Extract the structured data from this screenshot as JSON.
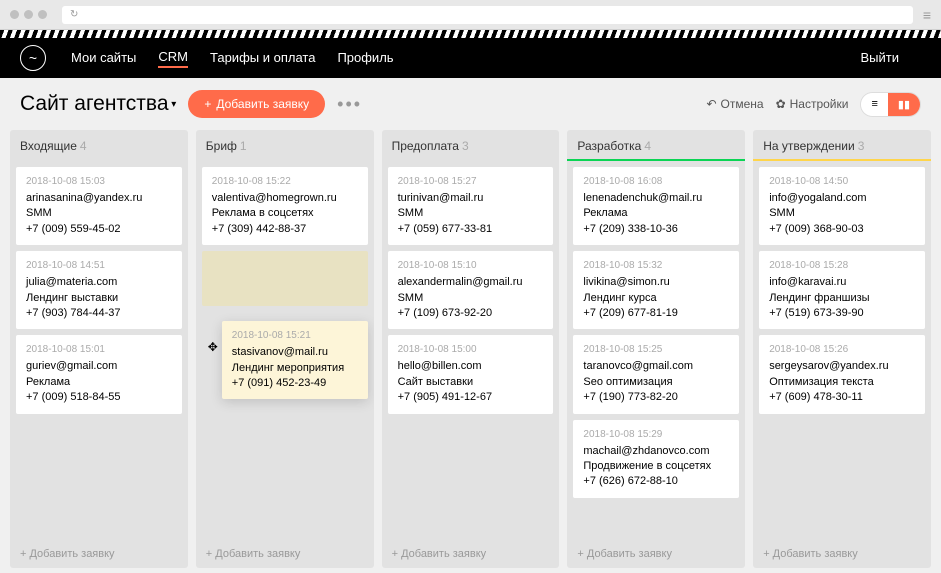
{
  "nav": {
    "items": [
      "Мои сайты",
      "CRM",
      "Тарифы и оплата",
      "Профиль"
    ],
    "logout": "Выйти"
  },
  "toolbar": {
    "site": "Сайт агентства",
    "add": "Добавить заявку",
    "cancel": "Отмена",
    "settings": "Настройки"
  },
  "columns": [
    {
      "name": "Входящие",
      "count": 4,
      "cards": [
        {
          "date": "2018-10-08 15:03",
          "email": "arinasanina@yandex.ru",
          "tag": "SMM",
          "phone": "+7 (009) 559-45-02"
        },
        {
          "date": "2018-10-08 14:51",
          "email": "julia@materia.com",
          "tag": "Лендинг выставки",
          "phone": "+7 (903) 784-44-37"
        },
        {
          "date": "2018-10-08 15:01",
          "email": "guriev@gmail.com",
          "tag": "Реклама",
          "phone": "+7 (009) 518-84-55"
        }
      ]
    },
    {
      "name": "Бриф",
      "count": 1,
      "cards": [
        {
          "date": "2018-10-08 15:22",
          "email": "valentiva@homegrown.ru",
          "tag": "Реклама в соцсетях",
          "phone": "+7 (309) 442-88-37"
        }
      ],
      "dragging": {
        "date": "2018-10-08 15:21",
        "email": "stasivanov@mail.ru",
        "tag": "Лендинг мероприятия",
        "phone": "+7 (091) 452-23-49"
      }
    },
    {
      "name": "Предоплата",
      "count": 3,
      "cards": [
        {
          "date": "2018-10-08 15:27",
          "email": "turinivan@mail.ru",
          "tag": "SMM",
          "phone": "+7 (059) 677-33-81"
        },
        {
          "date": "2018-10-08 15:10",
          "email": "alexandermalin@gmail.ru",
          "tag": "SMM",
          "phone": "+7 (109) 673-92-20"
        },
        {
          "date": "2018-10-08 15:00",
          "email": "hello@billen.com",
          "tag": "Сайт выставки",
          "phone": "+7 (905) 491-12-67"
        }
      ]
    },
    {
      "name": "Разработка",
      "count": 4,
      "color": "green",
      "cards": [
        {
          "date": "2018-10-08 16:08",
          "email": "lenenadenchuk@mail.ru",
          "tag": "Реклама",
          "phone": "+7 (209) 338-10-36"
        },
        {
          "date": "2018-10-08 15:32",
          "email": "livikina@simon.ru",
          "tag": "Лендинг курса",
          "phone": "+7 (209) 677-81-19"
        },
        {
          "date": "2018-10-08 15:25",
          "email": "taranovco@gmail.com",
          "tag": "Seo оптимизация",
          "phone": "+7 (190) 773-82-20"
        },
        {
          "date": "2018-10-08 15:29",
          "email": "machail@zhdanovco.com",
          "tag": "Продвижение в соцсетях",
          "phone": "+7 (626) 672-88-10"
        }
      ]
    },
    {
      "name": "На утверждении",
      "count": 3,
      "color": "yellow",
      "cards": [
        {
          "date": "2018-10-08 14:50",
          "email": "info@yogaland.com",
          "tag": "SMM",
          "phone": "+7 (009) 368-90-03"
        },
        {
          "date": "2018-10-08 15:28",
          "email": "info@karavai.ru",
          "tag": "Лендинг франшизы",
          "phone": "+7 (519) 673-39-90"
        },
        {
          "date": "2018-10-08 15:26",
          "email": "sergeysarov@yandex.ru",
          "tag": "Оптимизация текста",
          "phone": "+7 (609) 478-30-11"
        }
      ]
    }
  ],
  "addCard": "+ Добавить заявку"
}
